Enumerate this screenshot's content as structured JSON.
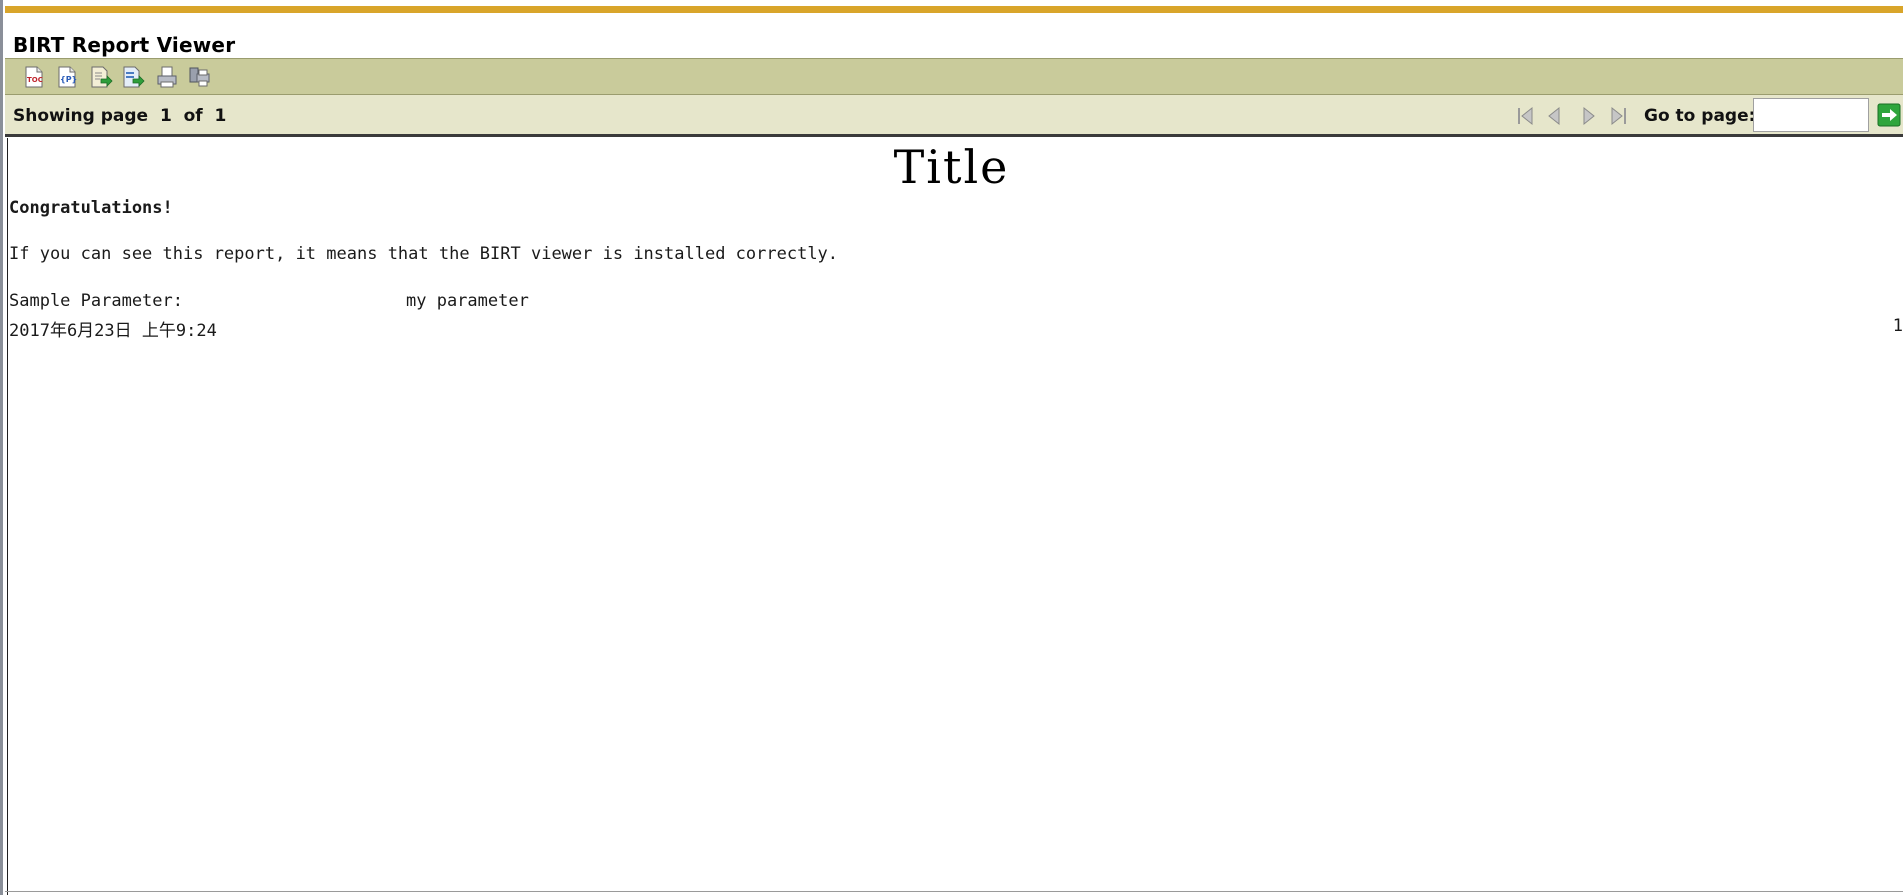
{
  "app": {
    "title": "BIRT Report Viewer"
  },
  "toolbar": {
    "buttons": [
      {
        "name": "toc-icon",
        "label": "TOC"
      },
      {
        "name": "parameters-icon",
        "label": "{P}"
      },
      {
        "name": "export-data-icon",
        "label": "Export Data"
      },
      {
        "name": "export-report-icon",
        "label": "Export Report"
      },
      {
        "name": "print-icon",
        "label": "Print"
      },
      {
        "name": "print-server-icon",
        "label": "Print on Server"
      }
    ],
    "bg_color": "#c9cb9b"
  },
  "navigation": {
    "showing_label": "Showing page",
    "current_page": "1",
    "of_label": "of",
    "total_pages": "1",
    "goto_label": "Go to page:",
    "goto_value": "",
    "bg_color": "#e6e6cb"
  },
  "report": {
    "title": "Title",
    "congrats": "Congratulations!",
    "message": "If you can see this report, it means that the BIRT viewer is installed correctly.",
    "param_label": "Sample Parameter:",
    "param_value": "my parameter",
    "timestamp": "2017年6月23日 上午9:24",
    "page_number": "1"
  },
  "colors": {
    "accent_top": "#d9a52a"
  }
}
